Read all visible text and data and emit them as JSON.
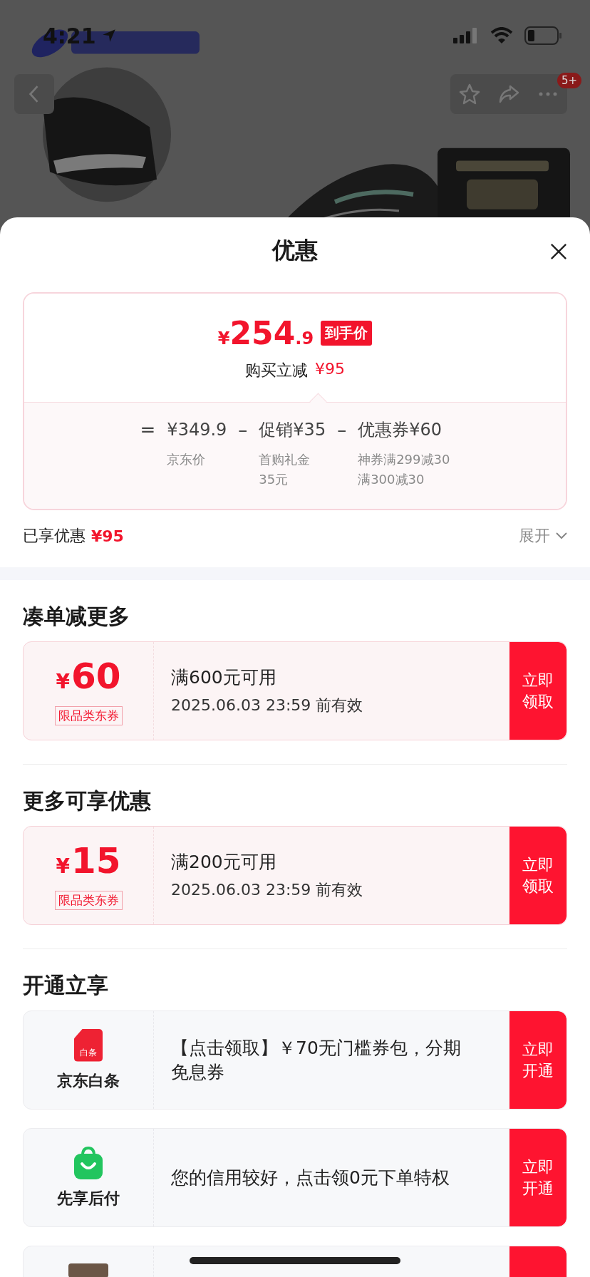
{
  "status_bar": {
    "time": "4:21"
  },
  "product_nav": {
    "badge": "5+"
  },
  "sheet": {
    "title": "优惠"
  },
  "price_card": {
    "currency": "¥",
    "price_integer": "254",
    "price_decimal": ".9",
    "price_tag": "到手价",
    "instant_label": "购买立减",
    "instant_amount": "¥95",
    "terms": [
      {
        "sign": "=",
        "amount": "¥349.9",
        "notes": [
          "京东价"
        ]
      },
      {
        "sign": "–",
        "amount": "促销¥35",
        "notes": [
          "首购礼金",
          "35元"
        ]
      },
      {
        "sign": "–",
        "amount": "优惠券¥60",
        "notes": [
          "神券满299减30",
          "满300减30"
        ]
      }
    ]
  },
  "savings": {
    "label": "已享优惠",
    "amount": "¥95"
  },
  "expand": {
    "label": "展开",
    "expanded": false
  },
  "sections": [
    {
      "title": "凑单减更多",
      "items": [
        {
          "kind": "coupon",
          "currency": "¥",
          "amount": "60",
          "tag": "限品类东券",
          "condition": "满600元可用",
          "validity": "2025.06.03 23:59 前有效",
          "action": "立即领取"
        }
      ]
    },
    {
      "title": "更多可享优惠",
      "items": [
        {
          "kind": "coupon",
          "currency": "¥",
          "amount": "15",
          "tag": "限品类东券",
          "condition": "满200元可用",
          "validity": "2025.06.03 23:59 前有效",
          "action": "立即领取"
        }
      ]
    },
    {
      "title": "开通立享",
      "items": [
        {
          "kind": "service",
          "icon_text": "白条",
          "name": "京东白条",
          "description": "【点击领取】￥70无门槛券包，分期免息券",
          "action": "立即开通"
        },
        {
          "kind": "service",
          "name": "先享后付",
          "description": "您的信用较好，点击领0元下单特权",
          "action": "立即开通"
        },
        {
          "kind": "partial"
        }
      ]
    }
  ]
}
